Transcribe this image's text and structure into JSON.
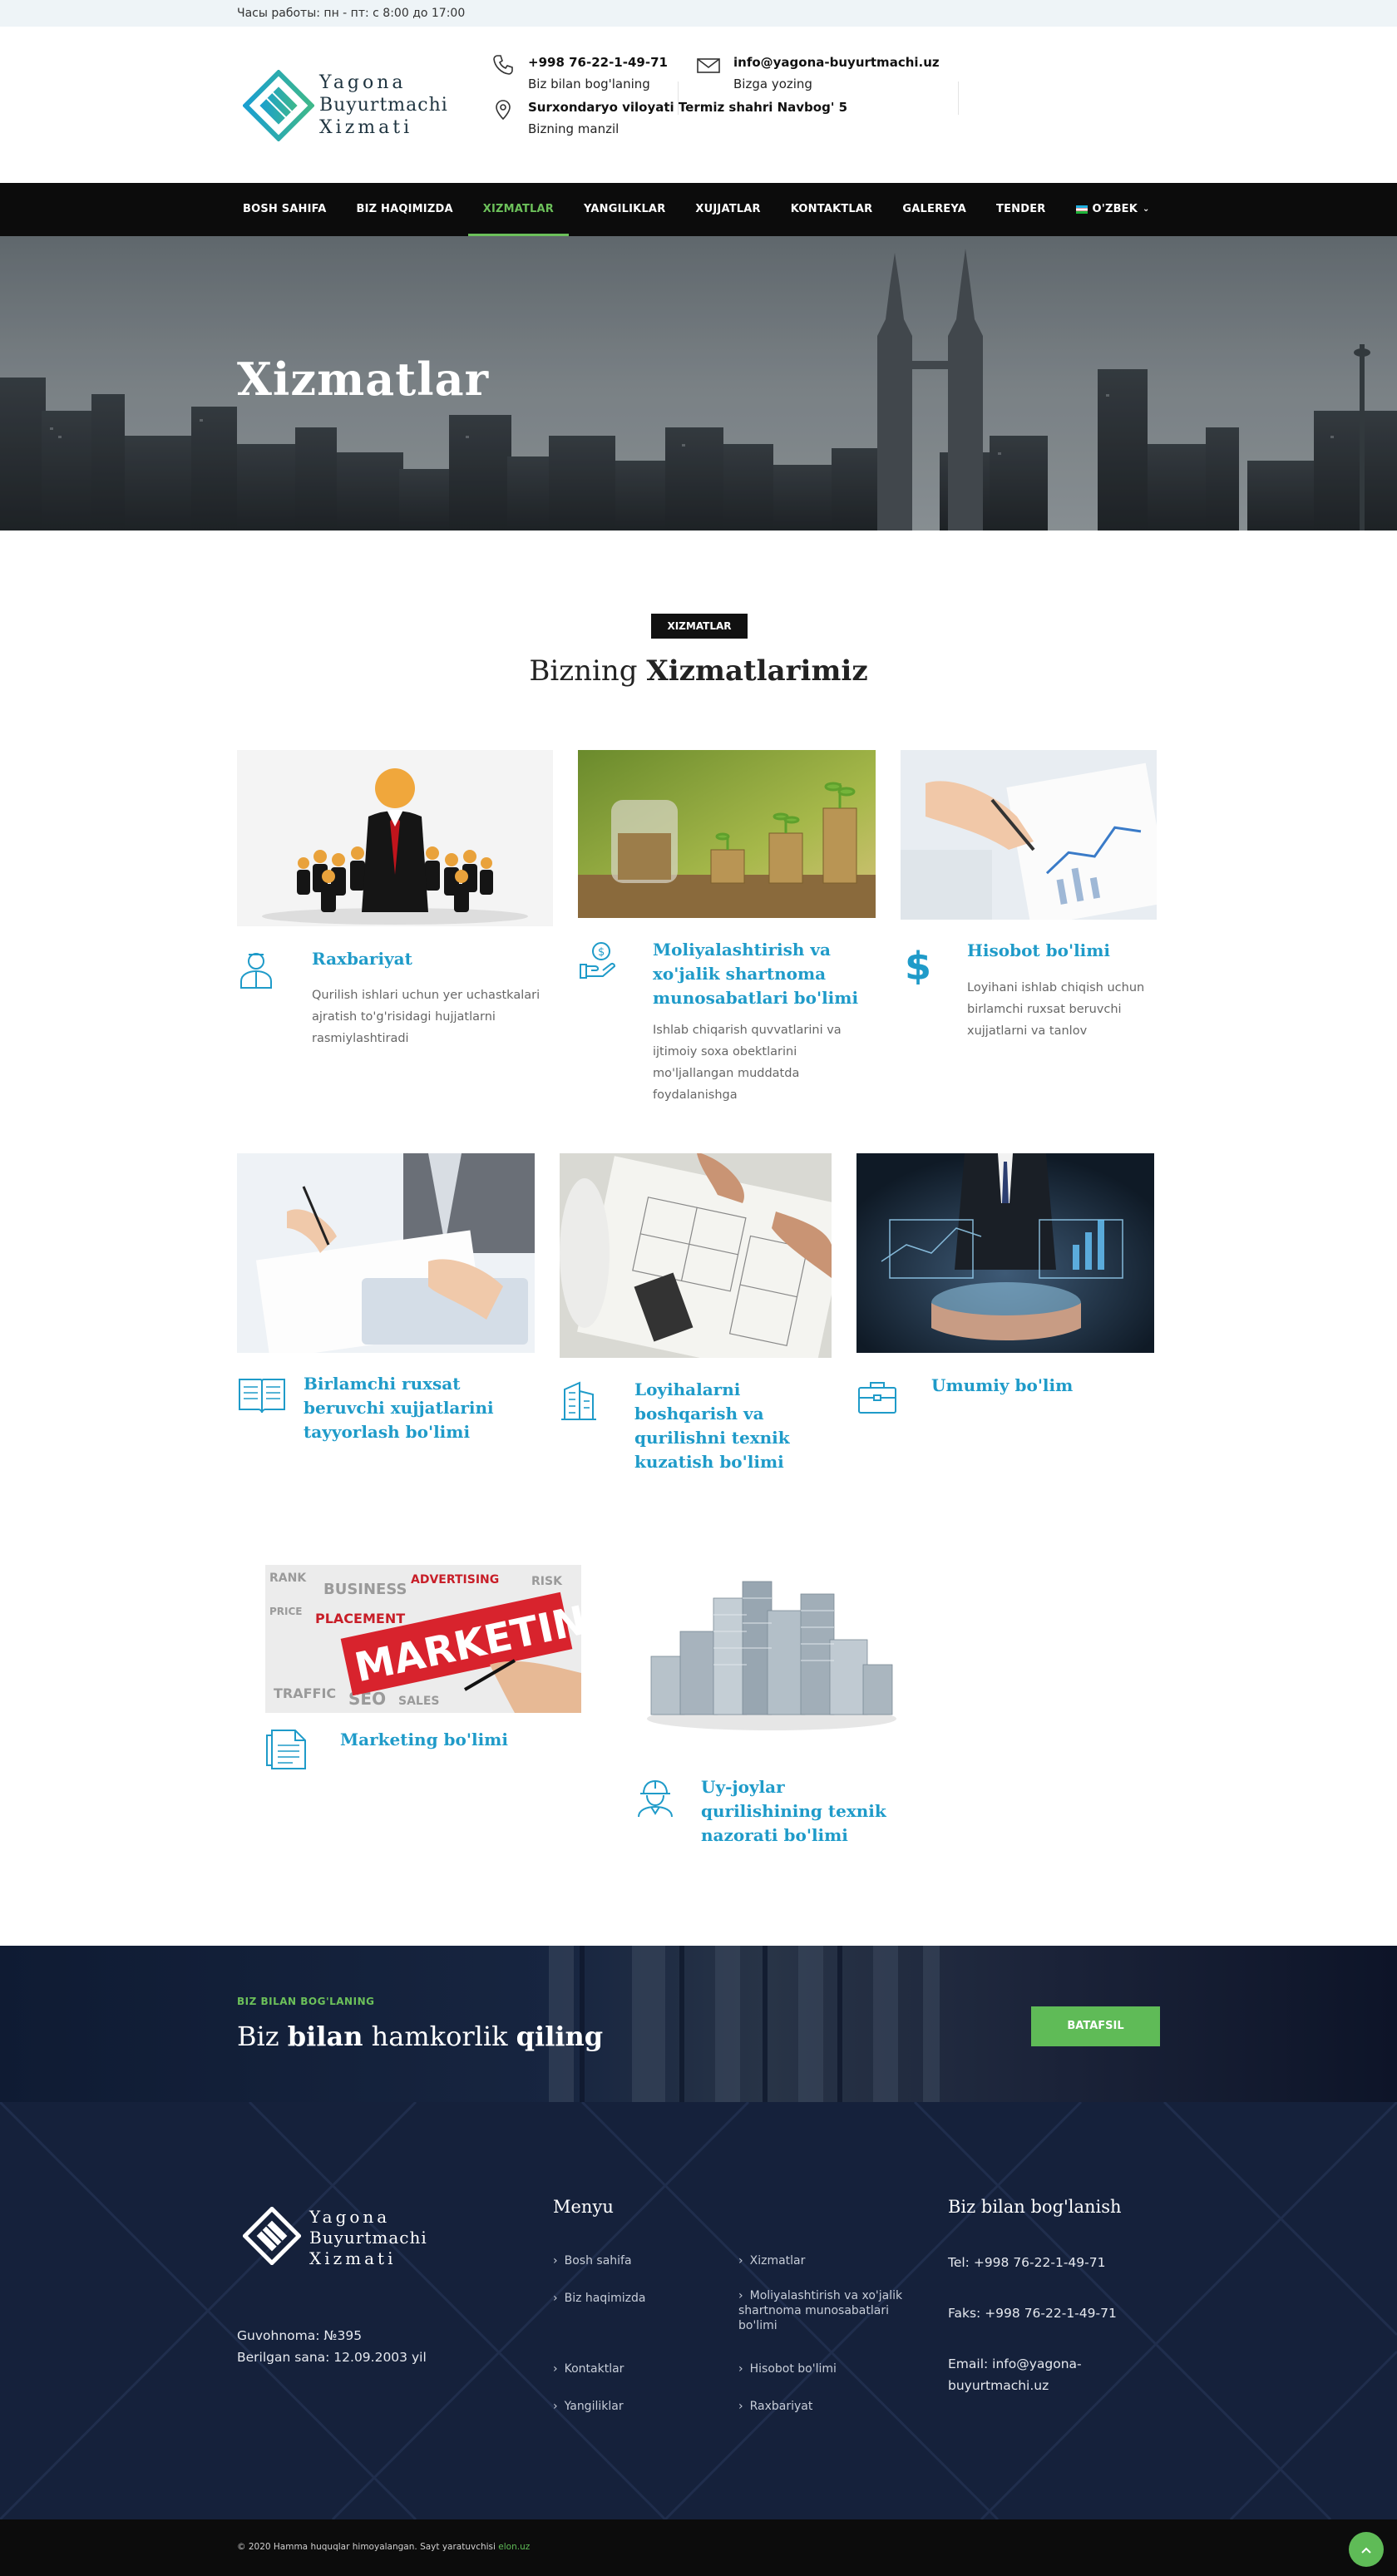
{
  "topbar": {
    "hours": "Часы работы: пн - пт: с 8:00 до 17:00"
  },
  "header": {
    "logo_line1": "Yagona",
    "logo_line2": "Buyurtmachi",
    "logo_line3": "Xizmati",
    "phone": "+998 76-22-1-49-71",
    "phone_caption": "Biz bilan bog'laning",
    "email": "info@yagona-buyurtmachi.uz",
    "email_caption": "Bizga yozing",
    "address": "Surxondaryo viloyati Termiz shahri Navbog' 5",
    "address_caption": "Bizning manzil"
  },
  "nav": {
    "items": [
      "BOSH SAHIFA",
      "BIZ HAQIMIZDA",
      "XIZMATLAR",
      "YANGILIKLAR",
      "XUJJATLAR",
      "KONTAKTLAR",
      "GALEREYA",
      "TENDER",
      "O'ZBEK"
    ],
    "active_index": 2
  },
  "hero": {
    "title": "Xizmatlar"
  },
  "section": {
    "badge": "XIZMATLAR",
    "title_normal": "Bizning",
    "title_bold": "Xizmatlarimiz"
  },
  "services": [
    {
      "title": "Raxbariyat",
      "text": "Qurilish ishlari uchun yer uchastkalari ajratish to'g'risidagi hujjatlarni rasmiylashtiradi",
      "icon": "manager-icon"
    },
    {
      "title": "Moliyalashtirish va xo'jalik shartnoma munosabatlari bo'limi",
      "text": "Ishlab chiqarish quvvatlarini va ijtimoiy soxa obektlarini mo'ljallangan muddatda foydalanishga",
      "icon": "money-hand-icon"
    },
    {
      "title": "Hisobot bo'limi",
      "text": "Loyihani ishlab chiqish uchun birlamchi ruxsat beruvchi xujjatlarni va tanlov",
      "icon": "dollar-icon"
    },
    {
      "title": "Birlamchi ruxsat beruvchi xujjatlarini tayyorlash bo'limi",
      "text": "",
      "icon": "book-icon"
    },
    {
      "title": "Loyihalarni boshqarish va qurilishni texnik kuzatish bo'limi",
      "text": "",
      "icon": "building-icon"
    },
    {
      "title": "Umumiy bo'lim",
      "text": "",
      "icon": "briefcase-icon"
    },
    {
      "title": "Marketing bo'limi",
      "text": "",
      "icon": "document-icon"
    },
    {
      "title": "Uy-joylar qurilishining texnik nazorati bo'limi",
      "text": "",
      "icon": "worker-icon"
    }
  ],
  "marketing_image_word": "MARKETING",
  "cta": {
    "small": "BIZ BILAN BOG'LANING",
    "part1": "Biz",
    "part2": "bilan",
    "part3": "hamkorlik",
    "part4": "qiling",
    "button": "BATAFSIL"
  },
  "footer": {
    "cert_line1": "Guvohnoma: №395",
    "cert_line2": "Berilgan sana: 12.09.2003 yil",
    "menu_title": "Menyu",
    "menu_col1": [
      "Bosh sahifa",
      "Biz haqimizda",
      "Kontaktlar",
      "Yangiliklar"
    ],
    "menu_col2": [
      "Xizmatlar",
      "Moliyalashtirish va xo'jalik shartnoma munosabatlari bo'limi",
      "Hisobot bo'limi",
      "Raxbariyat"
    ],
    "contact_title": "Biz bilan bog'lanish",
    "tel": "Tel: +998 76-22-1-49-71",
    "fax": "Faks: +998 76-22-1-49-71",
    "email_line1": "Email: info@yagona-",
    "email_line2": "buyurtmachi.uz"
  },
  "bottom": {
    "copyright": "© 2020 Hamma huquqlar himoyalangan. Sayt yaratuvchisi",
    "creator": "elon.uz"
  },
  "colors": {
    "accent": "#1f9bc9",
    "green": "#5fbb57",
    "nav": "#0c0c0c",
    "footer": "#15213b"
  }
}
